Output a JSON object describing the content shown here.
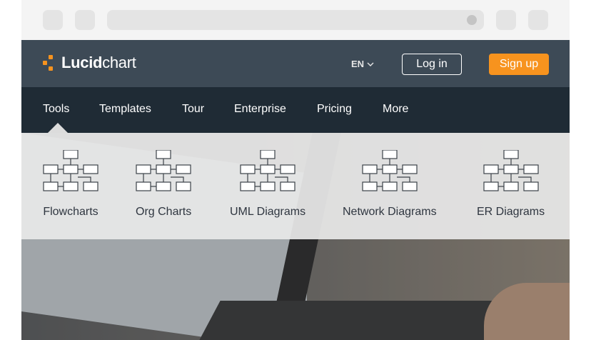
{
  "brand": {
    "name_bold": "Lucid",
    "name_light": "chart",
    "accent": "#f7931e"
  },
  "header": {
    "language": "EN",
    "login_label": "Log in",
    "signup_label": "Sign up"
  },
  "nav": {
    "items": [
      {
        "label": "Tools"
      },
      {
        "label": "Templates"
      },
      {
        "label": "Tour"
      },
      {
        "label": "Enterprise"
      },
      {
        "label": "Pricing"
      },
      {
        "label": "More"
      }
    ],
    "active": "Tools"
  },
  "tools_menu": {
    "items": [
      {
        "label": "Flowcharts",
        "icon": "flowchart-icon"
      },
      {
        "label": "Org Charts",
        "icon": "org-chart-icon"
      },
      {
        "label": "UML Diagrams",
        "icon": "uml-diagram-icon"
      },
      {
        "label": "Network Diagrams",
        "icon": "network-diagram-icon"
      },
      {
        "label": "ER Diagrams",
        "icon": "er-diagram-icon"
      }
    ]
  },
  "colors": {
    "topbar": "#3d4a56",
    "navbar": "#1f2b35",
    "signup": "#f7931e"
  }
}
